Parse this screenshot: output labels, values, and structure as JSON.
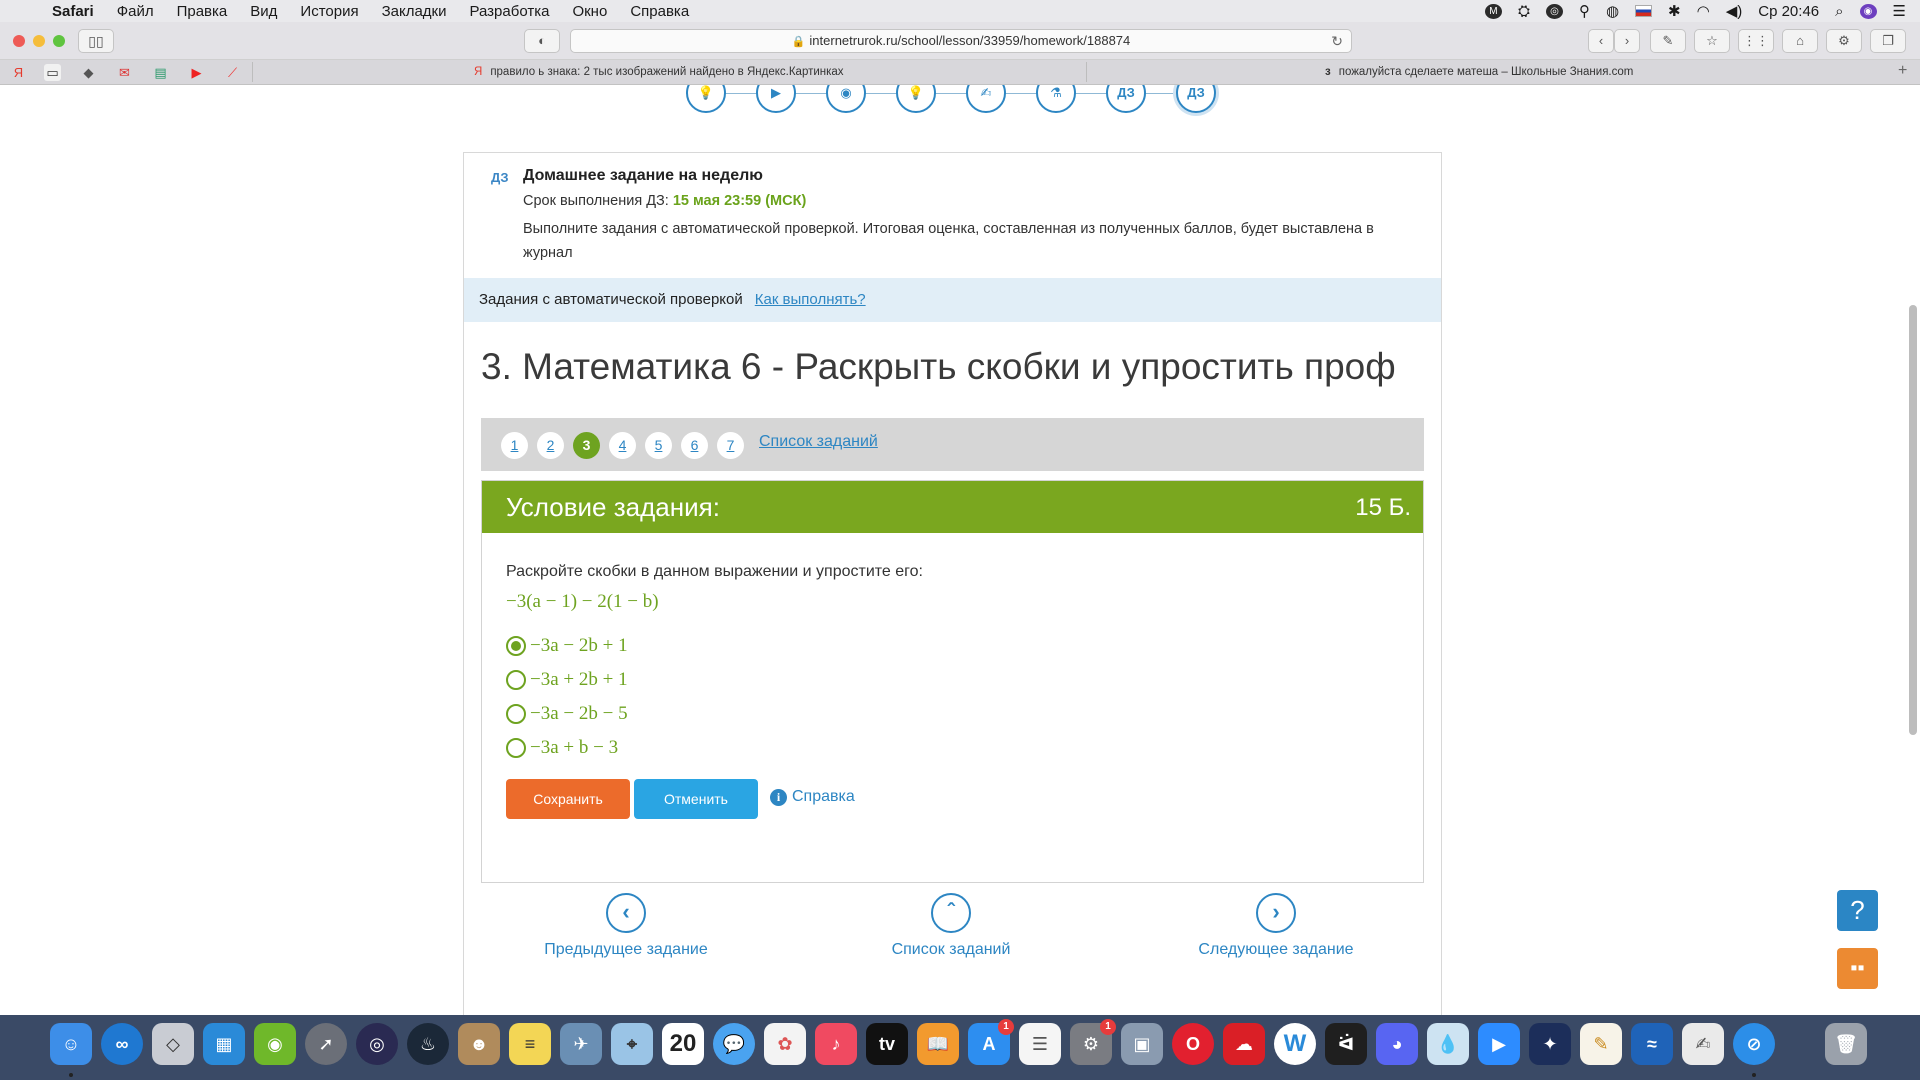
{
  "menubar": {
    "app": "Safari",
    "items": [
      "Файл",
      "Правка",
      "Вид",
      "История",
      "Закладки",
      "Разработка",
      "Окно",
      "Справка"
    ],
    "clock": "Ср 20:46"
  },
  "browser": {
    "url": "internetrurok.ru/school/lesson/33959/homework/188874",
    "tabs": [
      "правило ь знака: 2 тыс изображений найдено в Яндекс.Картинках",
      "пожалуйста сделаете матеша – Школьные Знания.com"
    ]
  },
  "steps": {
    "items": [
      "💡",
      "▶",
      "◉",
      "💡",
      "✍",
      "⚗",
      "ДЗ",
      "ДЗ"
    ]
  },
  "homework": {
    "badge": "ДЗ",
    "title": "Домашнее задание на неделю",
    "deadline_label": "Срок выполнения ДЗ:",
    "deadline_value": "15 мая 23:59 (МСК)",
    "description": "Выполните задания с автоматической проверкой. Итоговая оценка, составленная из полученных баллов, будет выставлена в журнал"
  },
  "auto_check": {
    "label": "Задания с автоматической проверкой",
    "how_link": "Как выполнять?"
  },
  "task": {
    "title": "3. Математика 6 - Раскрыть скобки и упростить проф",
    "numbers": [
      "1",
      "2",
      "3",
      "4",
      "5",
      "6",
      "7"
    ],
    "active_number": "3",
    "list_link": "Список заданий",
    "condition_label": "Условие задания:",
    "points": "15 Б.",
    "question": "Раскройте скобки в данном выражении и упростите его:",
    "expression": "−3(a − 1) − 2(1 − b)",
    "options": [
      "−3a − 2b + 1",
      "−3a + 2b + 1",
      "−3a − 2b − 5",
      "−3a + b − 3"
    ],
    "selected_option": 0,
    "save_label": "Сохранить",
    "cancel_label": "Отменить",
    "help_label": "Справка"
  },
  "navigation": {
    "prev": "Предыдущее задание",
    "list": "Список заданий",
    "next": "Следующее задание"
  },
  "colors": {
    "accent_green": "#7aa71f",
    "link_blue": "#2d86c3",
    "save_orange": "#ec6b2b",
    "cancel_blue": "#2aa5e3"
  }
}
